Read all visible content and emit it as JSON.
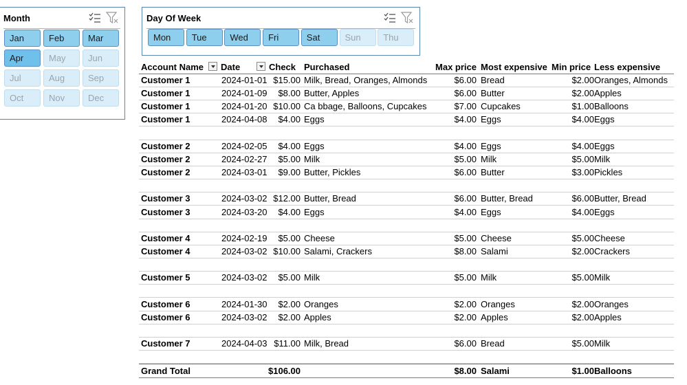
{
  "month_slicer": {
    "title": "Month",
    "buttons": [
      {
        "label": "Jan",
        "state": "sel"
      },
      {
        "label": "Feb",
        "state": "sel"
      },
      {
        "label": "Mar",
        "state": "sel"
      },
      {
        "label": "Apr",
        "state": "sel focus"
      },
      {
        "label": "May",
        "state": "nodata"
      },
      {
        "label": "Jun",
        "state": "nodata"
      },
      {
        "label": "Jul",
        "state": "nodata"
      },
      {
        "label": "Aug",
        "state": "nodata"
      },
      {
        "label": "Sep",
        "state": "nodata"
      },
      {
        "label": "Oct",
        "state": "nodata"
      },
      {
        "label": "Nov",
        "state": "nodata"
      },
      {
        "label": "Dec",
        "state": "nodata"
      }
    ]
  },
  "dow_slicer": {
    "title": "Day Of Week",
    "buttons": [
      {
        "label": "Mon",
        "state": "sel"
      },
      {
        "label": "Tue",
        "state": "sel"
      },
      {
        "label": "Wed",
        "state": "sel"
      },
      {
        "label": "Fri",
        "state": "sel"
      },
      {
        "label": "Sat",
        "state": "sel"
      },
      {
        "label": "Sun",
        "state": "nodata"
      },
      {
        "label": "Thu",
        "state": "nodata"
      }
    ]
  },
  "table": {
    "headers": {
      "account": "Account Name",
      "date": "Date",
      "check": "Check",
      "purchased": "Purchased",
      "max_price": "Max price",
      "most_expensive": "Most expensive",
      "min_price": "Min price",
      "less_expensive": "Less expensive"
    },
    "rows": [
      {
        "name": "Customer 1",
        "date": "2024-01-01",
        "check": "$15.00",
        "purchased": "Milk, Bread, Oranges, Almonds",
        "max": "$6.00",
        "most": "Bread",
        "min": "$2.00",
        "less": "Oranges, Almonds"
      },
      {
        "name": "Customer 1",
        "date": "2024-01-09",
        "check": "$8.00",
        "purchased": "Butter, Apples",
        "max": "$6.00",
        "most": "Butter",
        "min": "$2.00",
        "less": "Apples"
      },
      {
        "name": "Customer 1",
        "date": "2024-01-20",
        "check": "$10.00",
        "purchased": "Ca bbage, Balloons, Cupcakes",
        "max": "$7.00",
        "most": "Cupcakes",
        "min": "$1.00",
        "less": "Balloons"
      },
      {
        "name": "Customer 1",
        "date": "2024-04-08",
        "check": "$4.00",
        "purchased": "Eggs",
        "max": "$4.00",
        "most": "Eggs",
        "min": "$4.00",
        "less": "Eggs"
      },
      {
        "blank": true
      },
      {
        "name": "Customer 2",
        "date": "2024-02-05",
        "check": "$4.00",
        "purchased": "Eggs",
        "max": "$4.00",
        "most": "Eggs",
        "min": "$4.00",
        "less": "Eggs"
      },
      {
        "name": "Customer 2",
        "date": "2024-02-27",
        "check": "$5.00",
        "purchased": "Milk",
        "max": "$5.00",
        "most": "Milk",
        "min": "$5.00",
        "less": "Milk"
      },
      {
        "name": "Customer 2",
        "date": "2024-03-01",
        "check": "$9.00",
        "purchased": "Butter, Pickles",
        "max": "$6.00",
        "most": "Butter",
        "min": "$3.00",
        "less": "Pickles"
      },
      {
        "blank": true
      },
      {
        "name": "Customer 3",
        "date": "2024-03-02",
        "check": "$12.00",
        "purchased": "Butter, Bread",
        "max": "$6.00",
        "most": "Butter, Bread",
        "min": "$6.00",
        "less": "Butter, Bread"
      },
      {
        "name": "Customer 3",
        "date": "2024-03-20",
        "check": "$4.00",
        "purchased": "Eggs",
        "max": "$4.00",
        "most": "Eggs",
        "min": "$4.00",
        "less": "Eggs"
      },
      {
        "blank": true
      },
      {
        "name": "Customer 4",
        "date": "2024-02-19",
        "check": "$5.00",
        "purchased": "Cheese",
        "max": "$5.00",
        "most": "Cheese",
        "min": "$5.00",
        "less": "Cheese"
      },
      {
        "name": "Customer 4",
        "date": "2024-03-02",
        "check": "$10.00",
        "purchased": "Salami, Crackers",
        "max": "$8.00",
        "most": "Salami",
        "min": "$2.00",
        "less": "Crackers"
      },
      {
        "blank": true
      },
      {
        "name": "Customer 5",
        "date": "2024-03-02",
        "check": "$5.00",
        "purchased": "Milk",
        "max": "$5.00",
        "most": "Milk",
        "min": "$5.00",
        "less": "Milk"
      },
      {
        "blank": true
      },
      {
        "name": "Customer 6",
        "date": "2024-01-30",
        "check": "$2.00",
        "purchased": "Oranges",
        "max": "$2.00",
        "most": "Oranges",
        "min": "$2.00",
        "less": "Oranges"
      },
      {
        "name": "Customer 6",
        "date": "2024-03-02",
        "check": "$2.00",
        "purchased": "Apples",
        "max": "$2.00",
        "most": "Apples",
        "min": "$2.00",
        "less": "Apples"
      },
      {
        "blank": true
      },
      {
        "name": "Customer 7",
        "date": "2024-04-03",
        "check": "$11.00",
        "purchased": "Milk, Bread",
        "max": "$6.00",
        "most": "Bread",
        "min": "$5.00",
        "less": "Milk"
      },
      {
        "blank": true
      }
    ],
    "total": {
      "name": "Grand Total",
      "check": "$106.00",
      "max": "$8.00",
      "most": "Salami",
      "min": "$1.00",
      "less": "Balloons"
    }
  }
}
